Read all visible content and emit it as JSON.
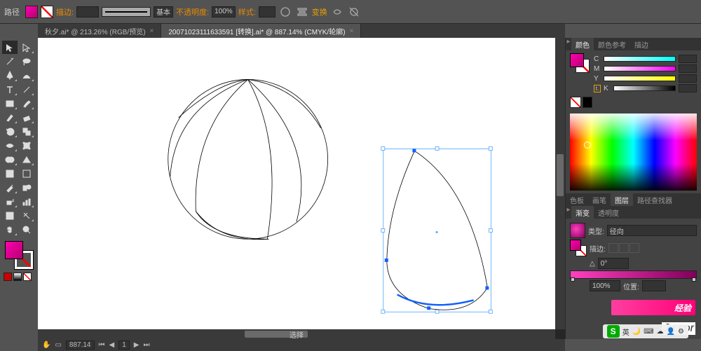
{
  "topbar": {
    "title": "路径",
    "stroke_label": "描边:",
    "stroke_pt": "",
    "profile_label": "基本",
    "opacity_label": "不透明度:",
    "opacity_value": "100%",
    "style_label": "样式:",
    "transform_label": "变换"
  },
  "tabs": [
    {
      "label": "秋夕.ai* @ 213.26% (RGB/预览)",
      "active": false
    },
    {
      "label": "20071023111633591 [转换].ai* @ 887.14% (CMYK/轮廓)",
      "active": true
    }
  ],
  "panels": {
    "color": {
      "tabs": [
        "颜色",
        "颜色参考",
        "描边"
      ],
      "active": 0,
      "channels": [
        {
          "ch": "C",
          "val": ""
        },
        {
          "ch": "M",
          "val": ""
        },
        {
          "ch": "Y",
          "val": ""
        },
        {
          "ch": "K",
          "val": ""
        }
      ]
    },
    "mid_tabs": [
      "色板",
      "画笔",
      "图层",
      "路径查找器"
    ],
    "mid_active": 2,
    "gradient": {
      "tabs": [
        "渐变",
        "透明度"
      ],
      "active": 0,
      "type_label": "类型:",
      "type_value": "径向",
      "stroke_label": "描边:",
      "angle_value": "0°",
      "opacity_value": "100%",
      "location_label": "位置:"
    }
  },
  "status": {
    "zoom": "887.14",
    "nav": "1",
    "selection": "选择"
  },
  "watermark": {
    "brand": "经验",
    "url": "Ju.cor"
  },
  "ime": {
    "lang": "英"
  }
}
